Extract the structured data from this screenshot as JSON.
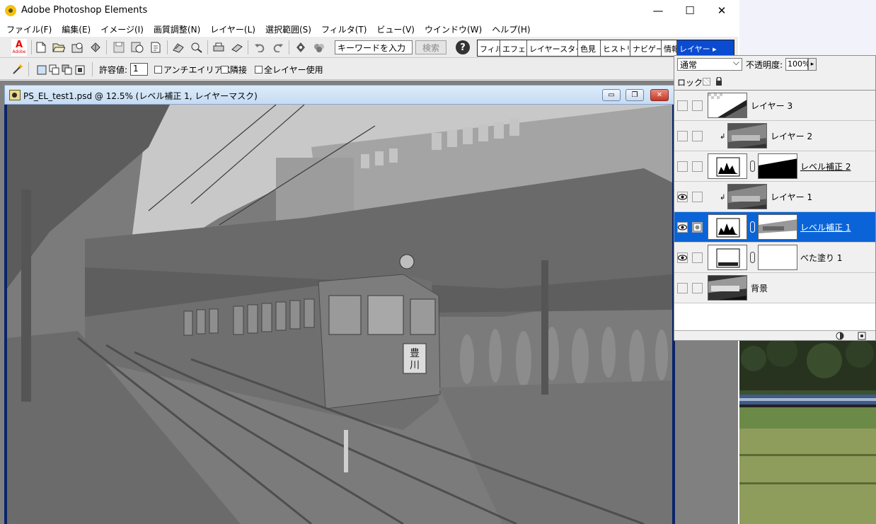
{
  "app": {
    "title": "Adobe Photoshop Elements",
    "window_controls": {
      "minimize": "—",
      "maximize": "☐",
      "close": "✕"
    }
  },
  "menu": [
    "ファイル(F)",
    "編集(E)",
    "イメージ(I)",
    "画質調整(N)",
    "レイヤー(L)",
    "選択範囲(S)",
    "フィルタ(T)",
    "ビュー(V)",
    "ウインドウ(W)",
    "ヘルプ(H)"
  ],
  "toolbar": {
    "adobe_logo_text": "Adobe",
    "icons": [
      "new-file-icon",
      "open-folder-icon",
      "browse-icon",
      "import-icon",
      "save-icon",
      "save-for-web-icon",
      "pdf-icon",
      "print-preview-icon",
      "print-icon",
      "scan-icon",
      "undo-icon",
      "redo-icon",
      "step-backward-icon",
      "color-palette-icon"
    ],
    "search_value": "キーワードを入力",
    "search_button": "検索",
    "help_icon": "?"
  },
  "palette_well": {
    "tabs": [
      "フィル",
      "エフェク",
      "レイヤースタイ",
      "色見",
      "ヒストリ",
      "ナビゲー",
      "情報",
      "レイヤー ▸"
    ],
    "active": 7
  },
  "options": {
    "tool_icon": "magic-wand-icon",
    "tolerance_label": "許容値:",
    "tolerance_value": "1",
    "antialias": "アンチエイリアス",
    "contiguous": "隣接",
    "all_layers": "全レイヤー使用"
  },
  "document": {
    "title": "PS_EL_test1.psd @ 12.5% (レベル補正 1, レイヤーマスク)",
    "controls": {
      "minimize": "▭",
      "restore": "❐",
      "close": "✕"
    }
  },
  "layers_palette": {
    "blend_mode": "通常",
    "opacity_label": "不透明度:",
    "opacity_value": "100%",
    "lock_label": "ロック:",
    "layers": [
      {
        "name": "レイヤー 3",
        "visible": false,
        "clipped": false,
        "adjustment": false,
        "selected": false
      },
      {
        "name": "レイヤー 2",
        "visible": false,
        "clipped": true,
        "adjustment": false,
        "selected": false
      },
      {
        "name": "レベル補正 2",
        "visible": false,
        "clipped": false,
        "adjustment": true,
        "selected": false
      },
      {
        "name": "レイヤー 1",
        "visible": true,
        "clipped": true,
        "adjustment": false,
        "selected": false
      },
      {
        "name": "レベル補正 1",
        "visible": true,
        "clipped": false,
        "adjustment": true,
        "selected": true
      },
      {
        "name": "べた塗り 1",
        "visible": true,
        "clipped": false,
        "adjustment": true,
        "selected": false
      },
      {
        "name": "背景",
        "visible": false,
        "clipped": false,
        "adjustment": false,
        "selected": false
      }
    ]
  },
  "canvas": {
    "sign_text_1": "豊",
    "sign_text_2": "川"
  },
  "colors": {
    "selection": "#0a64d8",
    "doc_frame": "#0a246a",
    "photo_gray": "#7d7d7d"
  }
}
